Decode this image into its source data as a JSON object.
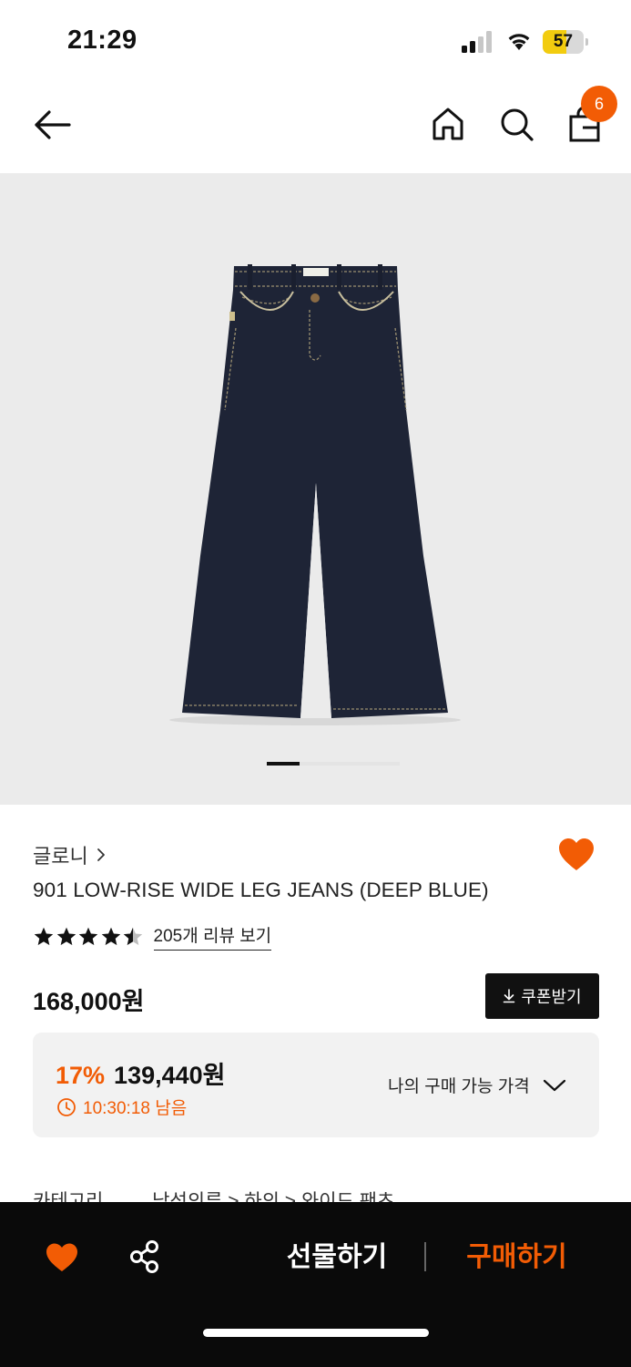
{
  "status_bar": {
    "time": "21:29",
    "battery_percent": "57",
    "battery_level": 0.57,
    "icons": [
      "signal-icon",
      "wifi-icon",
      "battery-icon"
    ]
  },
  "header": {
    "cart_count": "6",
    "icons": [
      "back-arrow-icon",
      "home-icon",
      "search-icon",
      "cart-icon"
    ]
  },
  "gallery": {
    "image": "dark-blue-wide-leg-jeans",
    "current_page": 1
  },
  "product": {
    "brand": "글로니",
    "title": "901 LOW-RISE WIDE LEG JEANS (DEEP BLUE)",
    "rating": 4.5,
    "rating_max": 5,
    "review_link": "205개 리뷰 보기",
    "price": "168,000원",
    "coupon_label": "쿠폰받기",
    "wishlisted": true
  },
  "discount": {
    "rate": "17%",
    "price": "139,440원",
    "timer": "10:30:18 남음",
    "my_price_label": "나의 구매 가능 가격"
  },
  "category": {
    "label": "카테고리",
    "path": "남성의류 > 하의 > 와이드 팬츠"
  },
  "bottom_bar": {
    "gift_label": "선물하기",
    "buy_label": "구매하기"
  },
  "colors": {
    "accent": "#f25c05",
    "dark": "#0a0a0a",
    "denim": "#1e2436"
  }
}
